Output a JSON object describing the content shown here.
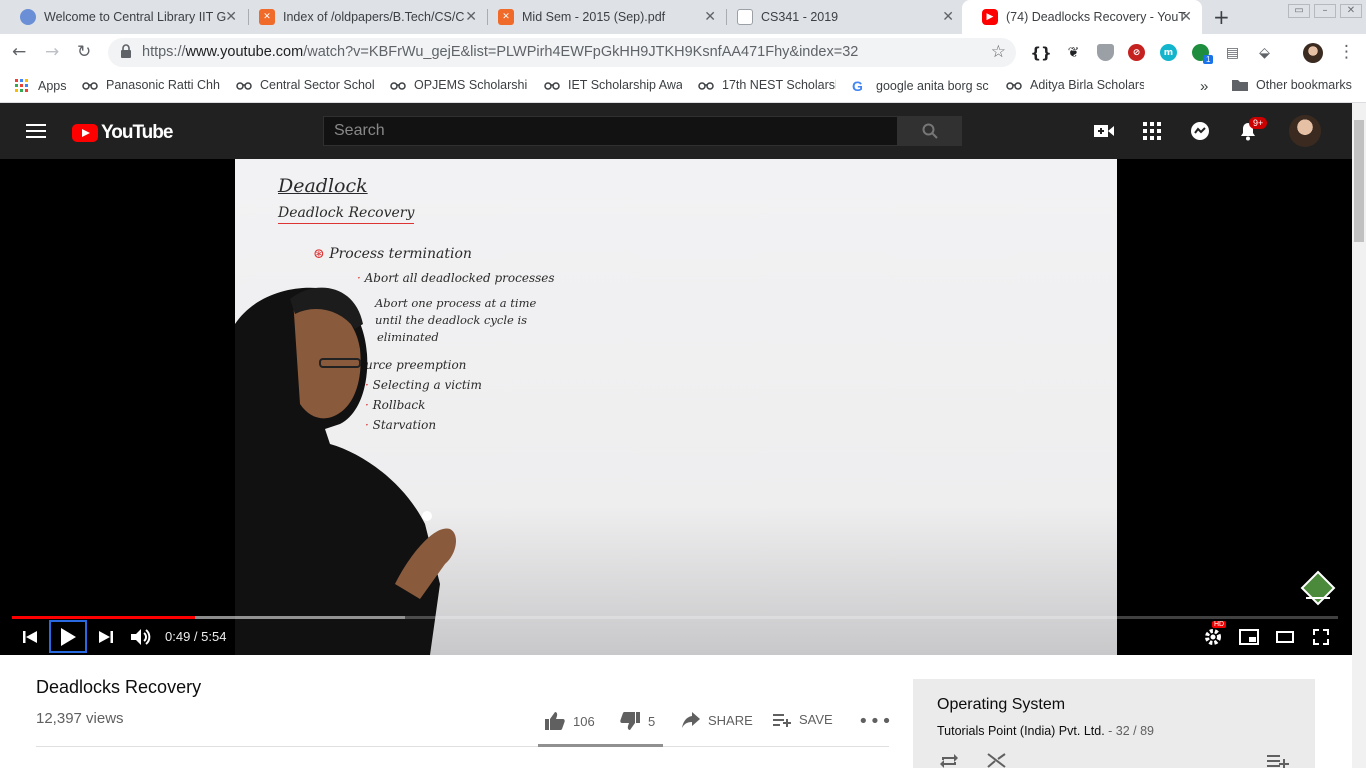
{
  "browser": {
    "tabs": [
      {
        "title": "Welcome to Central Library IIT G",
        "favicon": "library-favicon",
        "color": "#6b8fd6"
      },
      {
        "title": "Index of /oldpapers/B.Tech/CS/C",
        "favicon": "xampp-favicon",
        "color": "#f06a2a"
      },
      {
        "title": "Mid Sem - 2015 (Sep).pdf",
        "favicon": "xampp-favicon",
        "color": "#f06a2a"
      },
      {
        "title": "CS341 - 2019",
        "favicon": "document-favicon",
        "color": "#9aa0a6"
      },
      {
        "title": "(74) Deadlocks Recovery - YouT",
        "favicon": "youtube-favicon",
        "color": "#ff0000",
        "active": true
      }
    ],
    "url_prefix": "https://",
    "url_host": "www.youtube.com",
    "url_path": "/watch?v=KBFrWu_gejE&list=PLWPirh4EWFpGkHH9JTKH9KsnfAA471Fhy&index=32",
    "extensions": [
      "braces-icon",
      "gnome-icon",
      "shield-icon",
      "block-icon",
      "m-circle-icon",
      "green-dot-icon",
      "reader-icon",
      "map-pin-icon"
    ],
    "extension_badge": "1",
    "bookmarks": [
      {
        "label": "Apps",
        "icon": "apps-grid-icon"
      },
      {
        "label": "Panasonic Ratti Chha",
        "icon": "glasses-icon"
      },
      {
        "label": "Central Sector Schol",
        "icon": "glasses-icon"
      },
      {
        "label": "OPJEMS Scholarship",
        "icon": "glasses-icon"
      },
      {
        "label": "IET Scholarship Awa",
        "icon": "glasses-icon"
      },
      {
        "label": "17th NEST Scholarsh",
        "icon": "glasses-icon"
      },
      {
        "label": "google anita borg sc",
        "icon": "google-icon"
      },
      {
        "label": "Aditya Birla Scholars",
        "icon": "glasses-icon"
      }
    ],
    "bookmarks_overflow": "»",
    "other_bookmarks": "Other bookmarks"
  },
  "youtube": {
    "logo_text": "YouTube",
    "search_placeholder": "Search",
    "notification_count": "9+"
  },
  "player": {
    "board": {
      "title": "Deadlock",
      "subtitle": "Deadlock  Recovery",
      "lines": [
        "Process  termination",
        "Abort  all  deadlocked  processes",
        "Abort one process at a time",
        "until the deadlock cycle is",
        "eliminated",
        "urce  preemption",
        "Selecting  a victim",
        "Rollback",
        "Starvation"
      ]
    },
    "current_time": "0:49",
    "duration": "5:54",
    "time_separator": " / ",
    "progress_fraction": 0.138,
    "quality_badge": "HD"
  },
  "video": {
    "title": "Deadlocks Recovery",
    "views": "12,397 views",
    "likes": "106",
    "dislikes": "5",
    "share_label": "SHARE",
    "save_label": "SAVE",
    "more_label": "•••"
  },
  "playlist": {
    "title": "Operating System",
    "channel": "Tutorials Point (India) Pvt. Ltd.",
    "position": " - 32 / 89"
  }
}
